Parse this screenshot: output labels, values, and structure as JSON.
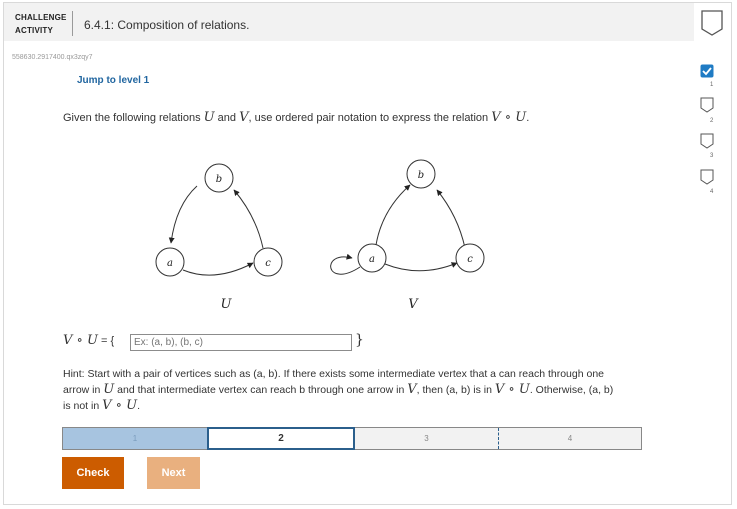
{
  "header": {
    "label_line1": "CHALLENGE",
    "label_line2": "ACTIVITY",
    "title": "6.4.1: Composition of relations."
  },
  "code": "558630.2917400.qx3zqy7",
  "jump_link": "Jump to level 1",
  "question": {
    "before": "Given the following relations ",
    "U": "U",
    "and": " and ",
    "V": "V",
    "after": ", use ordered pair notation to express the relation ",
    "VoU": "V ∘ U",
    "period": "."
  },
  "graphs": {
    "left": {
      "caption": "U",
      "nodes": {
        "a": "a",
        "b": "b",
        "c": "c"
      }
    },
    "right": {
      "caption": "V",
      "nodes": {
        "a": "a",
        "b": "b",
        "c": "c"
      }
    }
  },
  "answer": {
    "lhs_math": "V ∘ U",
    "lhs_rest": " = {",
    "placeholder": "Ex: (a, b), (b, c)",
    "value": "",
    "rbrace": "}"
  },
  "hint": {
    "p1": "Hint: Start with a pair of vertices such as (a, b). If there exists some intermediate vertex that a can reach through one arrow in ",
    "U": "U",
    "p2": " and that intermediate vertex can reach b through one arrow in ",
    "V": "V",
    "p3": ", then (a, b) is in ",
    "VoU1": "V ∘ U",
    "p4": ". Otherwise, (a, b) is not in ",
    "VoU2": "V ∘ U",
    "p5": "."
  },
  "levels": [
    "1",
    "2",
    "3",
    "4"
  ],
  "current_level": 2,
  "buttons": {
    "check": "Check",
    "next": "Next"
  },
  "side_levels": [
    {
      "num": "1",
      "done": true
    },
    {
      "num": "2",
      "done": false
    },
    {
      "num": "3",
      "done": false
    },
    {
      "num": "4",
      "done": false
    }
  ],
  "colors": {
    "accent": "#2b5f8c",
    "check": "#cc5c00",
    "next": "#e9b07f",
    "done": "#1f7bc4"
  }
}
